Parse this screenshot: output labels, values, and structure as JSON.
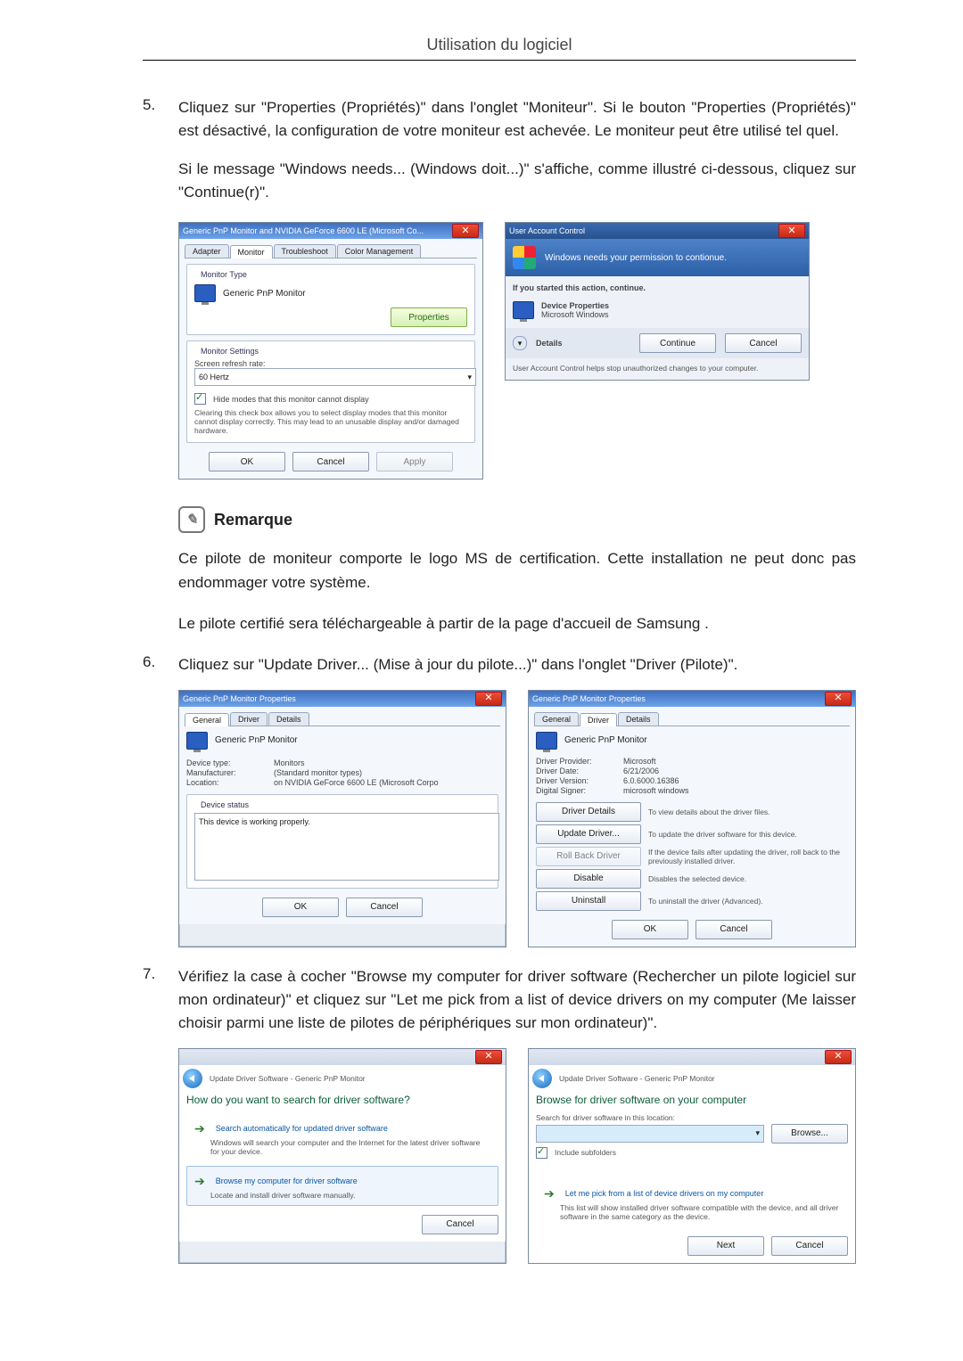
{
  "page": {
    "title": "Utilisation du logiciel"
  },
  "steps": {
    "s5": {
      "num": "5.",
      "body1": "Cliquez sur \"Properties (Propriétés)\" dans l'onglet \"Moniteur\". Si le bouton \"Properties (Propriétés)\" est désactivé, la configuration de votre moniteur est achevée. Le moniteur peut être utilisé tel quel.",
      "body2": "Si le message \"Windows needs... (Windows doit...)\" s'affiche, comme illustré ci-dessous, cliquez sur \"Continue(r)\"."
    },
    "s6": {
      "num": "6.",
      "body": "Cliquez sur \"Update Driver... (Mise à jour du pilote...)\" dans l'onglet \"Driver (Pilote)\"."
    },
    "s7": {
      "num": "7.",
      "body": "Vérifiez la case à cocher \"Browse my computer for driver software (Rechercher un pilote logiciel sur mon ordinateur)\" et cliquez sur \"Let me pick from a list of device drivers on my computer (Me laisser choisir parmi une liste de pilotes de périphériques sur mon ordinateur)\"."
    }
  },
  "note": {
    "title": "Remarque",
    "p1": "Ce pilote de moniteur comporte le logo MS de certification. Cette installation ne peut donc pas endommager votre système.",
    "p2": "Le pilote certifié sera téléchargeable à partir de la page d'accueil de Samsung ."
  },
  "dlgMonitor": {
    "title": "Generic PnP Monitor and NVIDIA GeForce 6600 LE (Microsoft Co...",
    "tabs": {
      "adapter": "Adapter",
      "monitor": "Monitor",
      "troubleshoot": "Troubleshoot",
      "color": "Color Management"
    },
    "monitorType": "Monitor Type",
    "deviceName": "Generic PnP Monitor",
    "propsBtn": "Properties",
    "settingsLegend": "Monitor Settings",
    "refreshLbl": "Screen refresh rate:",
    "refreshVal": "60 Hertz",
    "hideLbl": "Hide modes that this monitor cannot display",
    "hideNote": "Clearing this check box allows you to select display modes that this monitor cannot display correctly. This may lead to an unusable display and/or damaged hardware.",
    "ok": "OK",
    "cancel": "Cancel",
    "apply": "Apply"
  },
  "dlgUAC": {
    "title": "User Account Control",
    "banner": "Windows needs your permission to contionue.",
    "ifStarted": "If you started this action, continue.",
    "app": "Device Properties",
    "vendor": "Microsoft Windows",
    "details": "Details",
    "continue": "Continue",
    "cancel": "Cancel",
    "footer": "User Account Control helps stop unauthorized changes to your computer."
  },
  "dlgPropGeneral": {
    "title": "Generic PnP Monitor Properties",
    "tabs": {
      "general": "General",
      "driver": "Driver",
      "details": "Details"
    },
    "name": "Generic PnP Monitor",
    "deviceType_k": "Device type:",
    "deviceType_v": "Monitors",
    "manufacturer_k": "Manufacturer:",
    "manufacturer_v": "(Standard monitor types)",
    "location_k": "Location:",
    "location_v": "on NVIDIA GeForce 6600 LE (Microsoft Corpo",
    "statusLegend": "Device status",
    "statusText": "This device is working properly.",
    "ok": "OK",
    "cancel": "Cancel"
  },
  "dlgPropDriver": {
    "title": "Generic PnP Monitor Properties",
    "name": "Generic PnP Monitor",
    "provider_k": "Driver Provider:",
    "provider_v": "Microsoft",
    "date_k": "Driver Date:",
    "date_v": "6/21/2006",
    "version_k": "Driver Version:",
    "version_v": "6.0.6000.16386",
    "signer_k": "Digital Signer:",
    "signer_v": "microsoft windows",
    "btnDetails": "Driver Details",
    "txtDetails": "To view details about the driver files.",
    "btnUpdate": "Update Driver...",
    "txtUpdate": "To update the driver software for this device.",
    "btnRollback": "Roll Back Driver",
    "txtRollback": "If the device fails after updating the driver, roll back to the previously installed driver.",
    "btnDisable": "Disable",
    "txtDisable": "Disables the selected device.",
    "btnUninstall": "Uninstall",
    "txtUninstall": "To uninstall the driver (Advanced).",
    "ok": "OK",
    "cancel": "Cancel"
  },
  "dlgWiz1": {
    "breadcrumb": "Update Driver Software - Generic PnP Monitor",
    "heading": "How do you want to search for driver software?",
    "opt1_title": "Search automatically for updated driver software",
    "opt1_desc": "Windows will search your computer and the Internet for the latest driver software for your device.",
    "opt2_title": "Browse my computer for driver software",
    "opt2_desc": "Locate and install driver software manually.",
    "cancel": "Cancel"
  },
  "dlgWiz2": {
    "breadcrumb": "Update Driver Software - Generic PnP Monitor",
    "heading": "Browse for driver software on your computer",
    "searchLbl": "Search for driver software in this location:",
    "browse": "Browse...",
    "includeSub": "Include subfolders",
    "pick_title": "Let me pick from a list of device drivers on my computer",
    "pick_desc": "This list will show installed driver software compatible with the device, and all driver software in the same category as the device.",
    "next": "Next",
    "cancel": "Cancel"
  }
}
